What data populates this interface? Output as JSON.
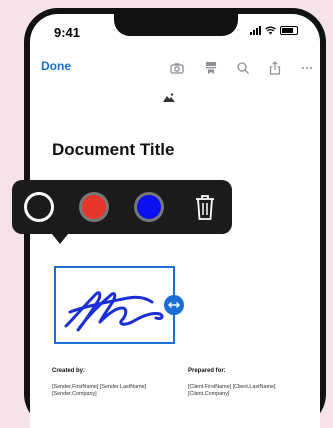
{
  "status": {
    "time": "9:41"
  },
  "toolbar": {
    "done_label": "Done",
    "icons": [
      "camera-icon",
      "bookmark-icon",
      "search-icon",
      "share-icon",
      "more-icon"
    ]
  },
  "document": {
    "title": "Document Title",
    "created_by_label": "Created by:",
    "created_by_line1": "[Sender.FirstName] [Sender.LastName]",
    "created_by_line2": "[Sender.Company]",
    "prepared_for_label": "Prepared for:",
    "prepared_for_line1": "[Client.FirstName] [Client.LastName]",
    "prepared_for_line2": "[Client.Company]"
  },
  "markup": {
    "colors": [
      "#ffffff",
      "#e8352b",
      "#0a10f0"
    ],
    "selected_color": "#ffffff"
  },
  "signature": {
    "stroke_color": "#1a2fd8"
  }
}
